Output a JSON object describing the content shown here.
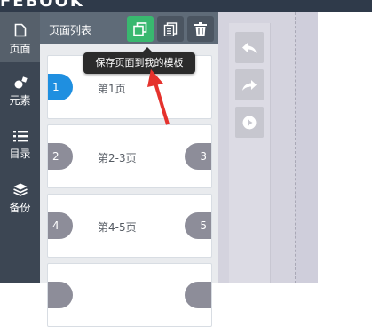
{
  "app": {
    "logo_text": "FEBOOK"
  },
  "sidebar": {
    "items": [
      {
        "label": "页面",
        "icon": "page-icon",
        "active": true
      },
      {
        "label": "元素",
        "icon": "shapes-icon",
        "active": false
      },
      {
        "label": "目录",
        "icon": "list-icon",
        "active": false
      },
      {
        "label": "备份",
        "icon": "layers-icon",
        "active": false
      }
    ]
  },
  "panel": {
    "title": "页面列表",
    "buttons": [
      {
        "name": "save-to-templates",
        "icon": "copy-icon",
        "color": "#39b86f"
      },
      {
        "name": "duplicate",
        "icon": "document-copy-icon"
      },
      {
        "name": "delete",
        "icon": "trash-icon"
      }
    ],
    "tooltip": "保存页面到我的模板",
    "cards": [
      {
        "label": "第1页",
        "left": "1",
        "right": null
      },
      {
        "label": "第2-3页",
        "left": "2",
        "right": "3"
      },
      {
        "label": "第4-5页",
        "left": "4",
        "right": "5"
      },
      {
        "label": "",
        "left": null,
        "right": null
      }
    ]
  },
  "tools": [
    {
      "name": "undo",
      "icon": "undo-icon"
    },
    {
      "name": "redo",
      "icon": "redo-icon"
    },
    {
      "name": "preview",
      "icon": "play-icon"
    }
  ],
  "colors": {
    "accent": "#39b86f",
    "selected_page": "#1f8fe0",
    "annotation_arrow": "#e5322d"
  }
}
